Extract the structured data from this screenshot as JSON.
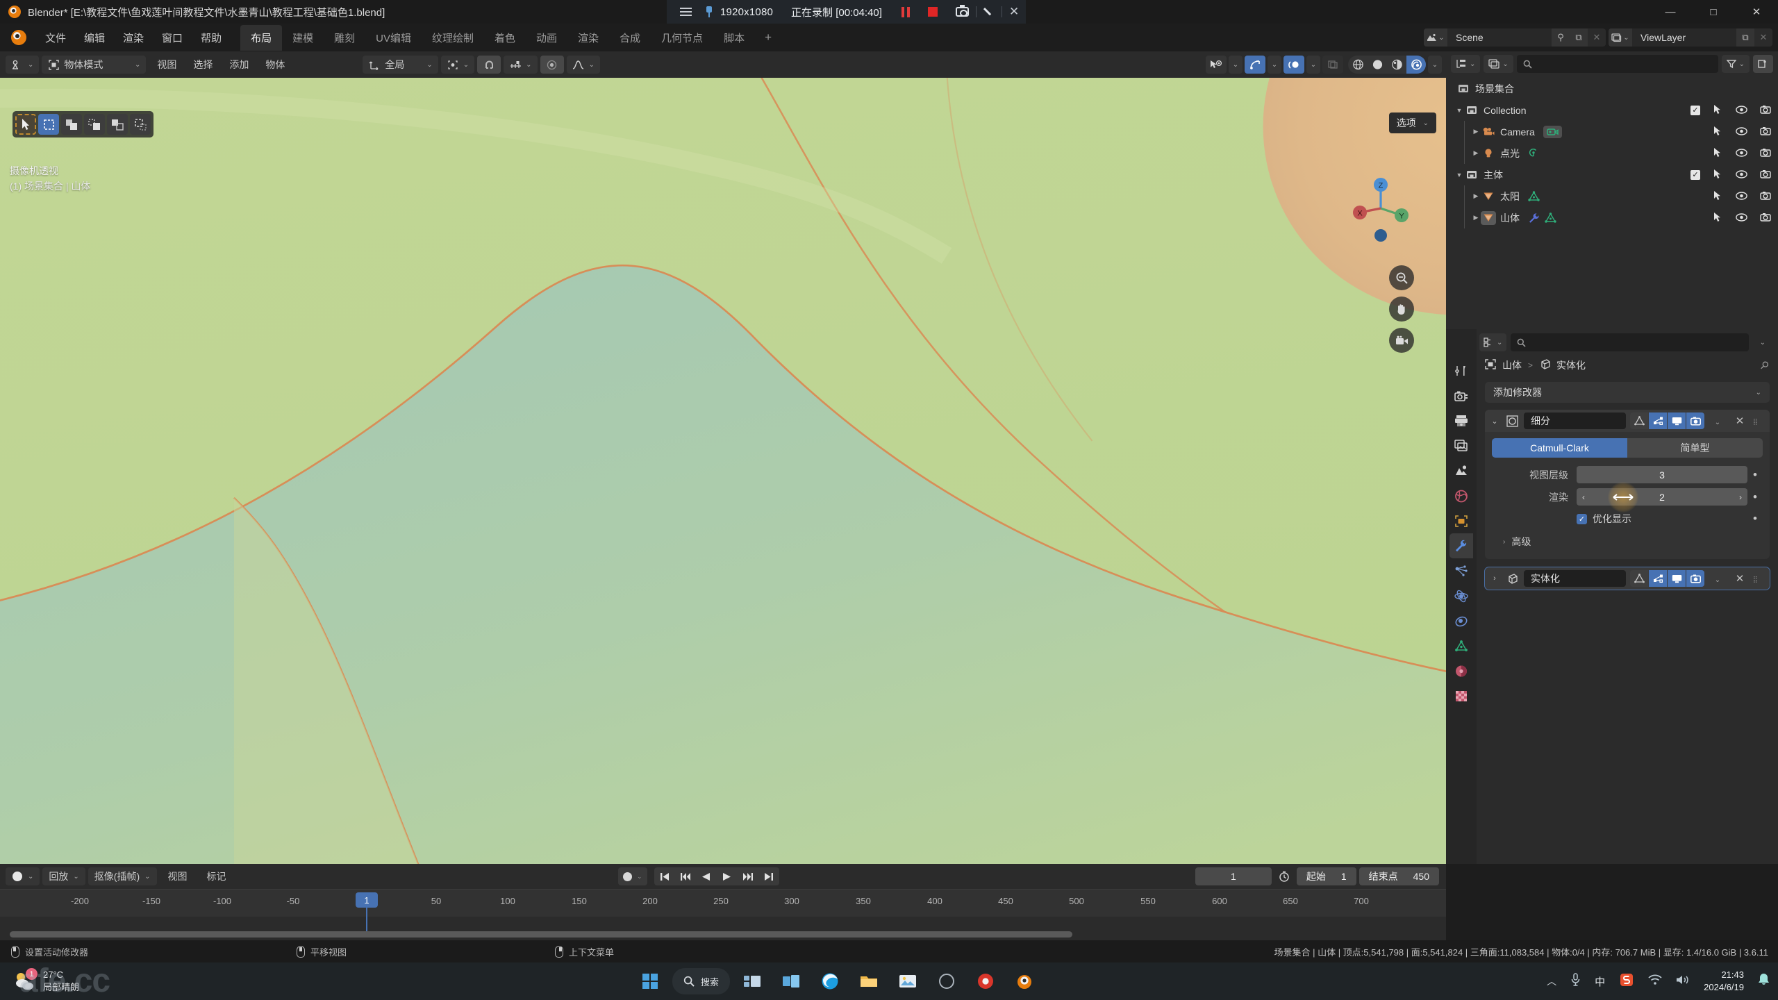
{
  "window": {
    "title": "Blender* [E:\\教程文件\\鱼戏莲叶间教程文件\\水墨青山\\教程工程\\基础色1.blend]",
    "minimize": "—",
    "maximize": "□",
    "close": "✕"
  },
  "recorder": {
    "resolution": "1920x1080",
    "status": "正在录制 [00:04:40]",
    "pause_title": "pause",
    "stop_title": "stop",
    "close": "✕"
  },
  "menubar": {
    "items": [
      "文件",
      "编辑",
      "渲染",
      "窗口",
      "帮助"
    ],
    "tabs": [
      "布局",
      "建模",
      "雕刻",
      "UV编辑",
      "纹理绘制",
      "着色",
      "动画",
      "渲染",
      "合成",
      "几何节点",
      "脚本"
    ],
    "active_tab": "布局",
    "add_tab": "+",
    "scene_name": "Scene",
    "viewlayer_name": "ViewLayer"
  },
  "viewport": {
    "header": {
      "editor_type": "editor-type",
      "mode": "物体模式",
      "menus": [
        "视图",
        "选择",
        "添加",
        "物体"
      ],
      "transform_orientation": "全局",
      "pivot": "pivot-point",
      "snap": "snap",
      "proportional": "proportional-edit"
    },
    "overlay_line1": "摄像机透视",
    "overlay_line2": "(1) 场景集合 | 山体",
    "options_label": "选项",
    "gizmo_axes": {
      "z": "Z",
      "x": "X",
      "y": "Y"
    }
  },
  "outliner": {
    "search_placeholder": "",
    "rows": [
      {
        "name": "场景集合",
        "level": 0,
        "icon": "collection-icon",
        "disclosure": "",
        "checkbox": false,
        "selected": false,
        "data_icons": []
      },
      {
        "name": "Collection",
        "level": 0,
        "icon": "collection-icon",
        "disclosure": "▼",
        "checkbox": true,
        "selected": false,
        "data_icons": []
      },
      {
        "name": "Camera",
        "level": 1,
        "icon": "camera-object-icon",
        "disclosure": "▶",
        "checkbox": false,
        "selected": false,
        "data_icons": [
          "camera-data-icon"
        ]
      },
      {
        "name": "点光",
        "level": 1,
        "icon": "light-object-icon",
        "disclosure": "▶",
        "checkbox": false,
        "selected": false,
        "data_icons": [
          "light-data-icon"
        ]
      },
      {
        "name": "主体",
        "level": 0,
        "icon": "collection-icon",
        "disclosure": "▼",
        "checkbox": true,
        "selected": false,
        "data_icons": []
      },
      {
        "name": "太阳",
        "level": 1,
        "icon": "mesh-object-icon",
        "disclosure": "▶",
        "checkbox": false,
        "selected": false,
        "data_icons": [
          "mesh-data-icon"
        ]
      },
      {
        "name": "山体",
        "level": 1,
        "icon": "mesh-object-icon",
        "disclosure": "▶",
        "checkbox": false,
        "selected": true,
        "data_icons": [
          "modifier-icon",
          "mesh-data-icon"
        ]
      }
    ]
  },
  "properties": {
    "search_placeholder": "",
    "breadcrumb_object": "山体",
    "breadcrumb_sep": ">",
    "breadcrumb_modifier": "实体化",
    "add_modifier": "添加修改器",
    "modifiers": [
      {
        "name": "细分",
        "expanded": true,
        "toggles": [
          {
            "name": "on-cage-toggle",
            "on": false
          },
          {
            "name": "edit-mode-toggle",
            "on": true
          },
          {
            "name": "realtime-toggle",
            "on": true
          },
          {
            "name": "render-toggle",
            "on": true
          }
        ],
        "subdiv_type": [
          "Catmull-Clark",
          "简单型"
        ],
        "subdiv_active": "Catmull-Clark",
        "viewport_levels_label": "视图层级",
        "viewport_levels_value": "3",
        "render_levels_label": "渲染",
        "render_levels_value": "2",
        "optimal_display_label": "优化显示",
        "optimal_display_checked": true,
        "advanced_label": "高级"
      },
      {
        "name": "实体化",
        "expanded": false,
        "toggles": [
          {
            "name": "on-cage-toggle",
            "on": false
          },
          {
            "name": "edit-mode-toggle",
            "on": true
          },
          {
            "name": "realtime-toggle",
            "on": true
          },
          {
            "name": "render-toggle",
            "on": true
          }
        ]
      }
    ]
  },
  "timeline": {
    "playback": "回放",
    "keying": "抠像(插帧)",
    "view": "视图",
    "marker": "标记",
    "current_frame": "1",
    "start_label": "起始",
    "start_value": "1",
    "end_label": "结束点",
    "end_value": "450",
    "ticks": [
      "-200",
      "-150",
      "-100",
      "-50",
      "50",
      "100",
      "150",
      "200",
      "250",
      "300",
      "350",
      "400",
      "450",
      "500",
      "550",
      "600",
      "650",
      "700"
    ],
    "playhead_label": "1"
  },
  "statusbar": {
    "hint_left": "设置活动修改器",
    "hint_mid": "平移视图",
    "hint_right": "上下文菜单",
    "stats": "场景集合 | 山体 | 顶点:5,541,798 | 面:5,541,824 | 三角面:11,083,584 | 物体:0/4 | 内存: 706.7 MiB | 显存: 1.4/16.0 GiB | 3.6.11"
  },
  "taskbar": {
    "weather_temp": "27°C",
    "weather_desc": "局部晴朗",
    "weather_badge": "1",
    "search_label": "搜索",
    "clock_time": "21:43",
    "clock_date": "2024/6/19",
    "watermark": "afe.cc"
  },
  "colors": {
    "accent_blue": "#4772b3",
    "record_red": "#e02626",
    "header_bg": "#2b2b2b",
    "panel_bg": "#333333",
    "viewport_green": "#b9cf8d",
    "viewport_teal": "#a9cbb2",
    "viewport_tan": "#ddbc8e",
    "outline_orange": "#d98a53"
  }
}
